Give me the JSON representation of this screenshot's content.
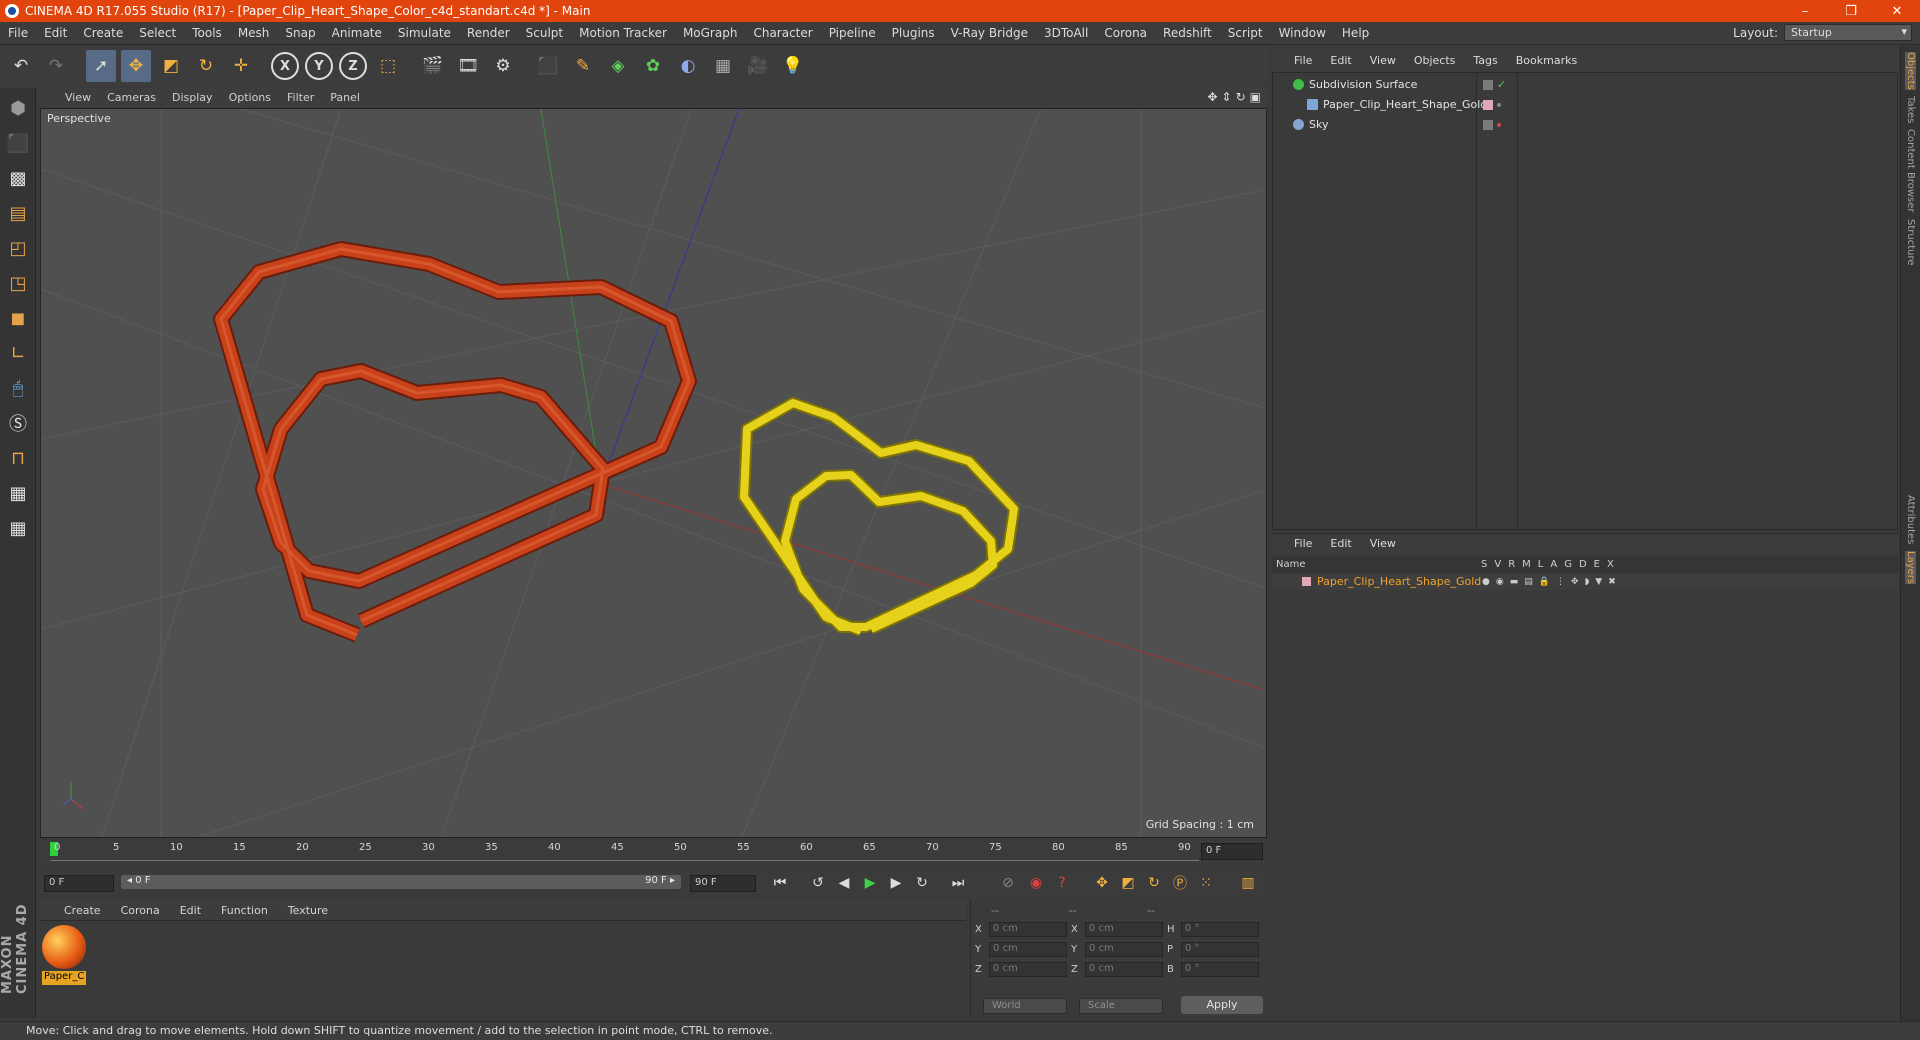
{
  "window": {
    "title": "CINEMA 4D R17.055 Studio (R17) - [Paper_Clip_Heart_Shape_Color_c4d_standart.c4d *] - Main",
    "controls": [
      "–",
      "❐",
      "✕"
    ]
  },
  "menu": [
    "File",
    "Edit",
    "Create",
    "Select",
    "Tools",
    "Mesh",
    "Snap",
    "Animate",
    "Simulate",
    "Render",
    "Sculpt",
    "Motion Tracker",
    "MoGraph",
    "Character",
    "Pipeline",
    "Plugins",
    "V-Ray Bridge",
    "3DToAll",
    "Corona",
    "Redshift",
    "Script",
    "Window",
    "Help"
  ],
  "layout": {
    "label": "Layout:",
    "value": "Startup"
  },
  "toolbar_axes": [
    "X",
    "Y",
    "Z"
  ],
  "viewport": {
    "menu": [
      "View",
      "Cameras",
      "Display",
      "Options",
      "Filter",
      "Panel"
    ],
    "label": "Perspective",
    "grid_spacing": "Grid Spacing : 1 cm",
    "red_clip_color": "#c8411a",
    "gold_clip_color": "#e6d21a"
  },
  "timeline": {
    "ticks": [
      "0",
      "5",
      "10",
      "15",
      "20",
      "25",
      "30",
      "35",
      "40",
      "45",
      "50",
      "55",
      "60",
      "65",
      "70",
      "75",
      "80",
      "85",
      "90"
    ],
    "current_frame": "0 F",
    "start_field": "0 F",
    "range_start": "◂ 0 F",
    "range_end": "90 F ▸",
    "end_field": "90 F"
  },
  "material_manager": {
    "menu": [
      "Create",
      "Corona",
      "Edit",
      "Function",
      "Texture"
    ],
    "material_name": "Paper_C"
  },
  "coordinates": {
    "headers": [
      "--",
      "--",
      "--"
    ],
    "rows": [
      {
        "a": "X",
        "av": "0 cm",
        "b": "X",
        "bv": "0 cm",
        "c": "H",
        "cv": "0 °"
      },
      {
        "a": "Y",
        "av": "0 cm",
        "b": "Y",
        "bv": "0 cm",
        "c": "P",
        "cv": "0 °"
      },
      {
        "a": "Z",
        "av": "0 cm",
        "b": "Z",
        "bv": "0 cm",
        "c": "B",
        "cv": "0 °"
      }
    ],
    "space": "World",
    "mode": "Scale",
    "apply": "Apply"
  },
  "object_manager": {
    "menu": [
      "File",
      "Edit",
      "View",
      "Objects",
      "Tags",
      "Bookmarks"
    ],
    "objects": [
      {
        "name": "Subdivision Surface",
        "indent": 0,
        "color": "#3fbd47"
      },
      {
        "name": "Paper_Clip_Heart_Shape_Gold",
        "indent": 1,
        "color": "#7ea7d8"
      },
      {
        "name": "Sky",
        "indent": 0,
        "color": "#86a5cf"
      }
    ]
  },
  "layer_manager": {
    "menu": [
      "File",
      "Edit",
      "View"
    ],
    "name_header": "Name",
    "columns": [
      "S",
      "V",
      "R",
      "M",
      "L",
      "A",
      "G",
      "D",
      "E",
      "X"
    ],
    "layer_name": "Paper_Clip_Heart_Shape_Gold"
  },
  "right_tabs": [
    "Objects",
    "Takes",
    "Content Browser",
    "Structure",
    "Attributes",
    "Layers"
  ],
  "logo": "MAXON CINEMA 4D",
  "status": "Move: Click and drag to move elements. Hold down SHIFT to quantize movement / add to the selection in point mode, CTRL to remove."
}
